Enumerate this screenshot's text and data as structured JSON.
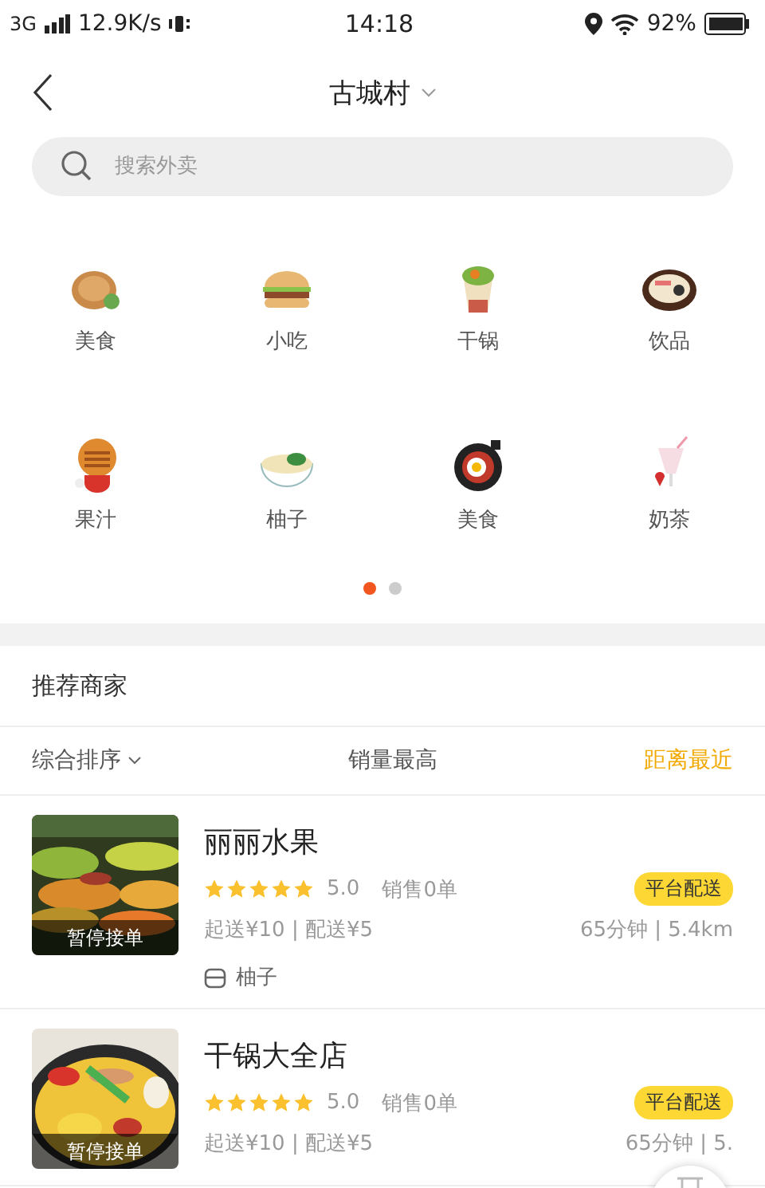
{
  "status_bar": {
    "network": "3G",
    "speed": "12.9K/s",
    "time": "14:18",
    "battery": "92%"
  },
  "nav": {
    "title": "古城村"
  },
  "search": {
    "placeholder": "搜索外卖"
  },
  "categories": [
    {
      "label": "美食"
    },
    {
      "label": "小吃"
    },
    {
      "label": "干锅"
    },
    {
      "label": "饮品"
    },
    {
      "label": "果汁"
    },
    {
      "label": "柚子"
    },
    {
      "label": "美食"
    },
    {
      "label": "奶茶"
    }
  ],
  "pager": [
    {
      "selected": true
    },
    {
      "selected": false
    }
  ],
  "section_title": "推荐商家",
  "sort_tabs": [
    {
      "label": "综合排序",
      "dropdown": true,
      "selected": false
    },
    {
      "label": "销量最高",
      "dropdown": false,
      "selected": false
    },
    {
      "label": "距离最近",
      "dropdown": false,
      "selected": true
    }
  ],
  "stores": [
    {
      "name": "丽丽水果",
      "status": "暂停接单",
      "stars": 5,
      "rating": "5.0",
      "sales": "销售0单",
      "badge": "平台配送",
      "fees": "起送¥10 | 配送¥5",
      "eta": "65分钟 | 5.4km",
      "category": "柚子",
      "kind": "fruit"
    },
    {
      "name": "干锅大全店",
      "status": "暂停接单",
      "stars": 5,
      "rating": "5.0",
      "sales": "销售0单",
      "badge": "平台配送",
      "fees": "起送¥10 | 配送¥5",
      "eta": "65分钟 | 5.",
      "kind": "dish"
    }
  ]
}
